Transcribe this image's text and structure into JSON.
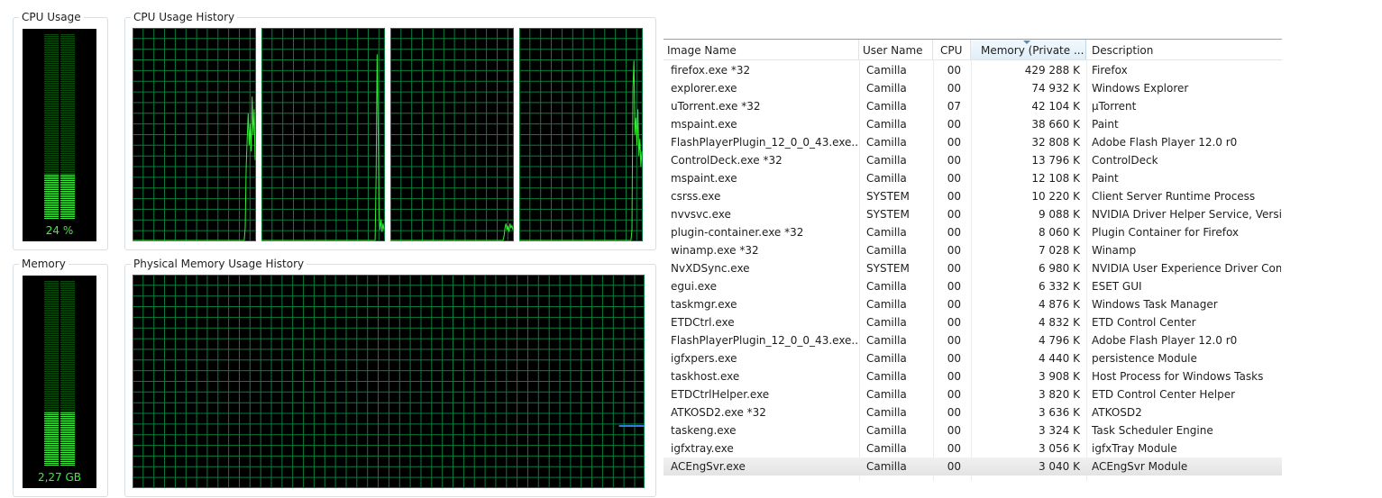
{
  "cpu_usage": {
    "title": "CPU Usage",
    "value_text": "24 %",
    "level": 0.24
  },
  "cpu_history": {
    "title": "CPU Usage History",
    "cores": [
      {
        "samples": [
          0,
          0,
          0,
          0,
          0,
          0,
          0,
          0,
          0,
          0,
          0,
          0,
          0,
          0,
          0,
          0,
          0,
          0,
          0,
          0,
          0,
          0,
          0,
          0,
          0,
          0,
          0,
          0,
          0,
          0,
          0,
          0,
          0,
          0,
          0,
          0,
          0,
          0,
          0,
          0,
          0,
          0,
          0,
          0,
          0,
          0,
          0,
          0,
          0,
          0,
          0,
          0,
          0,
          0,
          0,
          0,
          0,
          0,
          0,
          0,
          0,
          0,
          0,
          0,
          0,
          0,
          0,
          0,
          0,
          0,
          0,
          0,
          0,
          0,
          0,
          0,
          0,
          0,
          0,
          0,
          0,
          0,
          0,
          0,
          0,
          0,
          0,
          0,
          0,
          0,
          0,
          0,
          0,
          0,
          0,
          0,
          0,
          0,
          0,
          0,
          0,
          0,
          0,
          0,
          0,
          0,
          0,
          0,
          0,
          0,
          0,
          0,
          0,
          0,
          0.06,
          0.35,
          0.48,
          0.6,
          0.45,
          0.55,
          0.42,
          0.68,
          0.5,
          0.62,
          0.38
        ]
      },
      {
        "samples": [
          0,
          0,
          0,
          0,
          0,
          0,
          0,
          0,
          0,
          0,
          0,
          0,
          0,
          0,
          0,
          0,
          0,
          0,
          0,
          0,
          0,
          0,
          0,
          0,
          0,
          0,
          0,
          0,
          0,
          0,
          0,
          0,
          0,
          0,
          0,
          0,
          0,
          0,
          0,
          0,
          0,
          0,
          0,
          0,
          0,
          0,
          0,
          0,
          0,
          0,
          0,
          0,
          0,
          0,
          0,
          0,
          0,
          0,
          0,
          0,
          0,
          0,
          0,
          0,
          0,
          0,
          0,
          0,
          0,
          0,
          0,
          0,
          0,
          0,
          0,
          0,
          0,
          0,
          0,
          0,
          0,
          0,
          0,
          0,
          0,
          0,
          0,
          0,
          0,
          0,
          0,
          0,
          0,
          0,
          0,
          0,
          0,
          0,
          0,
          0,
          0,
          0,
          0,
          0,
          0,
          0,
          0,
          0,
          0,
          0,
          0,
          0,
          0,
          0,
          0,
          0,
          0.3,
          0.88,
          0.55,
          0.12,
          0.05,
          0.1,
          0.04,
          0.08,
          0.05
        ]
      },
      {
        "samples": [
          0,
          0,
          0,
          0,
          0,
          0,
          0,
          0,
          0,
          0,
          0,
          0,
          0,
          0,
          0,
          0,
          0,
          0,
          0,
          0,
          0,
          0,
          0,
          0,
          0,
          0,
          0,
          0,
          0,
          0,
          0,
          0,
          0,
          0,
          0,
          0,
          0,
          0,
          0,
          0,
          0,
          0,
          0,
          0,
          0,
          0,
          0,
          0,
          0,
          0,
          0,
          0,
          0,
          0,
          0,
          0,
          0,
          0,
          0,
          0,
          0,
          0,
          0,
          0,
          0,
          0,
          0,
          0,
          0,
          0,
          0,
          0,
          0,
          0,
          0,
          0,
          0,
          0,
          0,
          0,
          0,
          0,
          0,
          0,
          0,
          0,
          0,
          0,
          0,
          0,
          0,
          0,
          0,
          0,
          0,
          0,
          0,
          0,
          0,
          0,
          0,
          0,
          0,
          0,
          0,
          0,
          0,
          0,
          0,
          0,
          0,
          0,
          0,
          0,
          0,
          0.02,
          0.06,
          0.08,
          0.05,
          0.07,
          0.04,
          0.08,
          0.06,
          0.07,
          0.05
        ]
      },
      {
        "samples": [
          0,
          0,
          0,
          0,
          0,
          0,
          0,
          0,
          0,
          0,
          0,
          0,
          0,
          0,
          0,
          0,
          0,
          0,
          0,
          0,
          0,
          0,
          0,
          0,
          0,
          0,
          0,
          0,
          0,
          0,
          0,
          0,
          0,
          0,
          0,
          0,
          0,
          0,
          0,
          0,
          0,
          0,
          0,
          0,
          0,
          0,
          0,
          0,
          0,
          0,
          0,
          0,
          0,
          0,
          0,
          0,
          0,
          0,
          0,
          0,
          0,
          0,
          0,
          0,
          0,
          0,
          0,
          0,
          0,
          0,
          0,
          0,
          0,
          0,
          0,
          0,
          0,
          0,
          0,
          0,
          0,
          0,
          0,
          0,
          0,
          0,
          0,
          0,
          0,
          0,
          0,
          0,
          0,
          0,
          0,
          0,
          0,
          0,
          0,
          0,
          0,
          0,
          0,
          0,
          0,
          0,
          0,
          0,
          0,
          0,
          0,
          0,
          0,
          0,
          0.05,
          0.72,
          0.85,
          0.5,
          0.58,
          0.45,
          0.62,
          0.4,
          0.48,
          0.35,
          0.42
        ]
      }
    ]
  },
  "memory": {
    "title": "Memory",
    "value_text": "2,27 GB",
    "level": 0.29
  },
  "memory_history": {
    "title": "Physical Memory Usage History",
    "level": 0.29,
    "fill_start": 0.95
  },
  "colors": {
    "graph_line": "#33ee33",
    "grid": "#0a7d3c",
    "meter_on": "#3ef03e",
    "meter_off": "#0b4d0b",
    "memory_line": "#2f7be6"
  },
  "table": {
    "columns": [
      "Image Name",
      "User Name",
      "CPU",
      "Memory (Private ...",
      "Description"
    ],
    "sorted_column": 3,
    "selected_row": 22,
    "rows": [
      [
        "firefox.exe *32",
        "Camilla",
        "00",
        "429 288 K",
        "Firefox"
      ],
      [
        "explorer.exe",
        "Camilla",
        "00",
        "74 932 K",
        "Windows Explorer"
      ],
      [
        "uTorrent.exe *32",
        "Camilla",
        "07",
        "42 104 K",
        "µTorrent"
      ],
      [
        "mspaint.exe",
        "Camilla",
        "00",
        "38 660 K",
        "Paint"
      ],
      [
        "FlashPlayerPlugin_12_0_0_43.exe...",
        "Camilla",
        "00",
        "32 808 K",
        "Adobe Flash Player 12.0 r0"
      ],
      [
        "ControlDeck.exe *32",
        "Camilla",
        "00",
        "13 796 K",
        "ControlDeck"
      ],
      [
        "mspaint.exe",
        "Camilla",
        "00",
        "12 108 K",
        "Paint"
      ],
      [
        "csrss.exe",
        "SYSTEM",
        "00",
        "10 220 K",
        "Client Server Runtime Process"
      ],
      [
        "nvvsvc.exe",
        "SYSTEM",
        "00",
        "9 088 K",
        "NVIDIA Driver Helper Service, Version"
      ],
      [
        "plugin-container.exe *32",
        "Camilla",
        "00",
        "8 060 K",
        "Plugin Container for Firefox"
      ],
      [
        "winamp.exe *32",
        "Camilla",
        "00",
        "7 028 K",
        "Winamp"
      ],
      [
        "NvXDSync.exe",
        "SYSTEM",
        "00",
        "6 980 K",
        "NVIDIA User Experience Driver Comp"
      ],
      [
        "egui.exe",
        "Camilla",
        "00",
        "6 332 K",
        "ESET GUI"
      ],
      [
        "taskmgr.exe",
        "Camilla",
        "00",
        "4 876 K",
        "Windows Task Manager"
      ],
      [
        "ETDCtrl.exe",
        "Camilla",
        "00",
        "4 832 K",
        "ETD Control Center"
      ],
      [
        "FlashPlayerPlugin_12_0_0_43.exe...",
        "Camilla",
        "00",
        "4 796 K",
        "Adobe Flash Player 12.0 r0"
      ],
      [
        "igfxpers.exe",
        "Camilla",
        "00",
        "4 440 K",
        "persistence Module"
      ],
      [
        "taskhost.exe",
        "Camilla",
        "00",
        "3 908 K",
        "Host Process for Windows Tasks"
      ],
      [
        "ETDCtrlHelper.exe",
        "Camilla",
        "00",
        "3 820 K",
        "ETD Control Center Helper"
      ],
      [
        "ATKOSD2.exe *32",
        "Camilla",
        "00",
        "3 636 K",
        "ATKOSD2"
      ],
      [
        "taskeng.exe",
        "Camilla",
        "00",
        "3 324 K",
        "Task Scheduler Engine"
      ],
      [
        "igfxtray.exe",
        "Camilla",
        "00",
        "3 056 K",
        "igfxTray Module"
      ],
      [
        "ACEngSvr.exe",
        "Camilla",
        "00",
        "3 040 K",
        "ACEngSvr Module"
      ]
    ]
  }
}
